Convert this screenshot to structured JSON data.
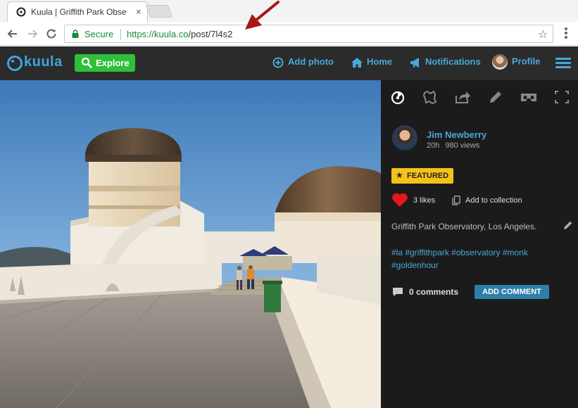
{
  "browser": {
    "tab_title": "Kuula | Griffith Park Obse",
    "tab_close": "×",
    "security_label": "Secure",
    "url_domain": "https://kuula.co",
    "url_path": "/post/7l4s2",
    "star_glyph": "☆"
  },
  "header": {
    "logo_text": "kuula",
    "explore_label": "Explore",
    "nav": [
      {
        "label": "Add photo",
        "icon": "plus-circle-icon"
      },
      {
        "label": "Home",
        "icon": "home-icon"
      },
      {
        "label": "Notifications",
        "icon": "megaphone-icon"
      },
      {
        "label": "Profile",
        "icon": "avatar"
      }
    ],
    "menu_icon": "hamburger-icon"
  },
  "panel": {
    "tools": [
      "compass-icon",
      "map-icon",
      "share-icon",
      "edit-icon",
      "vr-headset-icon",
      "fullscreen-icon"
    ],
    "author": {
      "name": "Jim Newberry",
      "time": "20h",
      "views": "980 views"
    },
    "featured_label": "FEATURED",
    "likes_label": "3 likes",
    "collection_label": "Add to collection",
    "description": "Griffith Park Observatory, Los Angeles.",
    "tags_line1": "#la #griffithpark #observatory #monk",
    "tags_line2": "#goldenhour",
    "comments_label": "0 comments",
    "add_comment_label": "ADD COMMENT"
  },
  "colors": {
    "accent_blue": "#4aa8d8",
    "explore_green": "#2fbf3b",
    "featured_yellow": "#f4c21a",
    "heart_red": "#e8161c",
    "header_bg": "#2b2b2b",
    "panel_bg": "#1b1b1b"
  }
}
